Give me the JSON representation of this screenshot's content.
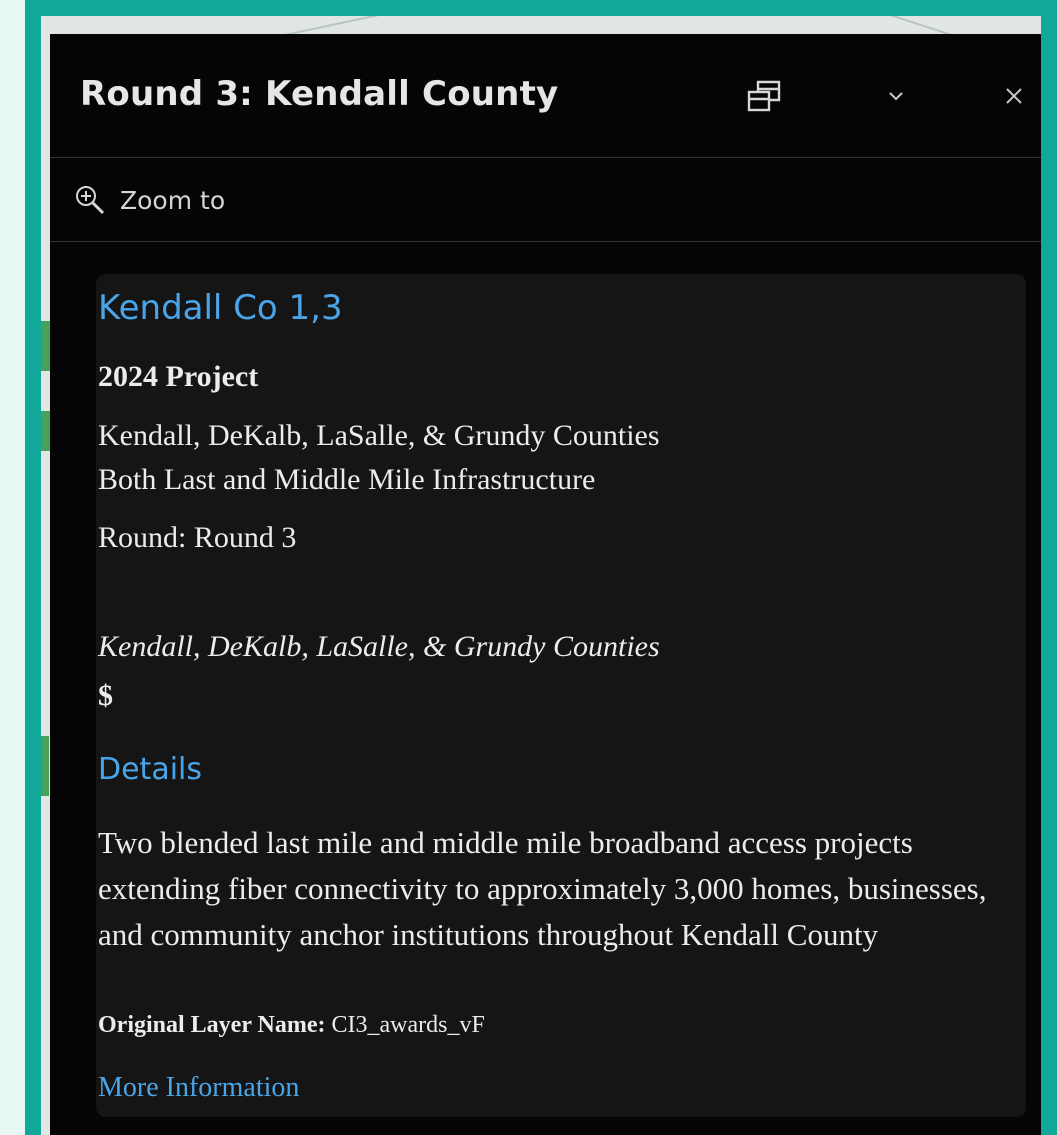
{
  "panel": {
    "title": "Round 3: Kendall County",
    "header_icons": [
      "dock-icon",
      "chevron-down-icon",
      "close-icon"
    ],
    "zoom_label": "Zoom to"
  },
  "feature": {
    "title": "Kendall Co 1,3",
    "project_year": "2024 Project",
    "counties": "Kendall, DeKalb, LaSalle, & Grundy Counties",
    "infrastructure": "Both Last and Middle Mile Infrastructure",
    "round": "Round: Round 3",
    "counties_italic": "Kendall, DeKalb, LaSalle, & Grundy Counties",
    "amount": "$",
    "details_heading": "Details",
    "description": "Two blended last mile and middle mile broadband access projects extending fiber connectivity to approximately 3,000 homes, businesses, and community anchor institutions throughout Kendall County",
    "layer_name_label": "Original Layer Name:",
    "layer_name_value": " CI3_awards_vF",
    "more_info": "More Information"
  },
  "colors": {
    "frame": "#11a89a",
    "panel_bg": "#050505",
    "card_bg": "#151515",
    "accent": "#4aa5e8",
    "text": "#ececec"
  }
}
